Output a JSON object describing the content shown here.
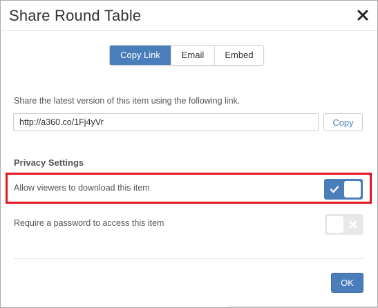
{
  "dialog": {
    "title": "Share Round Table",
    "close_icon": "close-icon"
  },
  "tabs": [
    {
      "label": "Copy Link",
      "active": true
    },
    {
      "label": "Email",
      "active": false
    },
    {
      "label": "Embed",
      "active": false
    }
  ],
  "copy_link": {
    "description": "Share the latest version of this item using the following link.",
    "url": "http://a360.co/1Fj4yVr",
    "copy_label": "Copy"
  },
  "privacy": {
    "title": "Privacy Settings",
    "options": [
      {
        "label": "Allow viewers to download this item",
        "enabled": true,
        "icon": "check-icon"
      },
      {
        "label": "Require a password to access this item",
        "enabled": false,
        "icon": "x-icon"
      }
    ]
  },
  "footer": {
    "ok_label": "OK"
  },
  "colors": {
    "accent": "#4a7ebb",
    "highlight": "#e3131f",
    "toggle_off": "#e8e8e8"
  }
}
